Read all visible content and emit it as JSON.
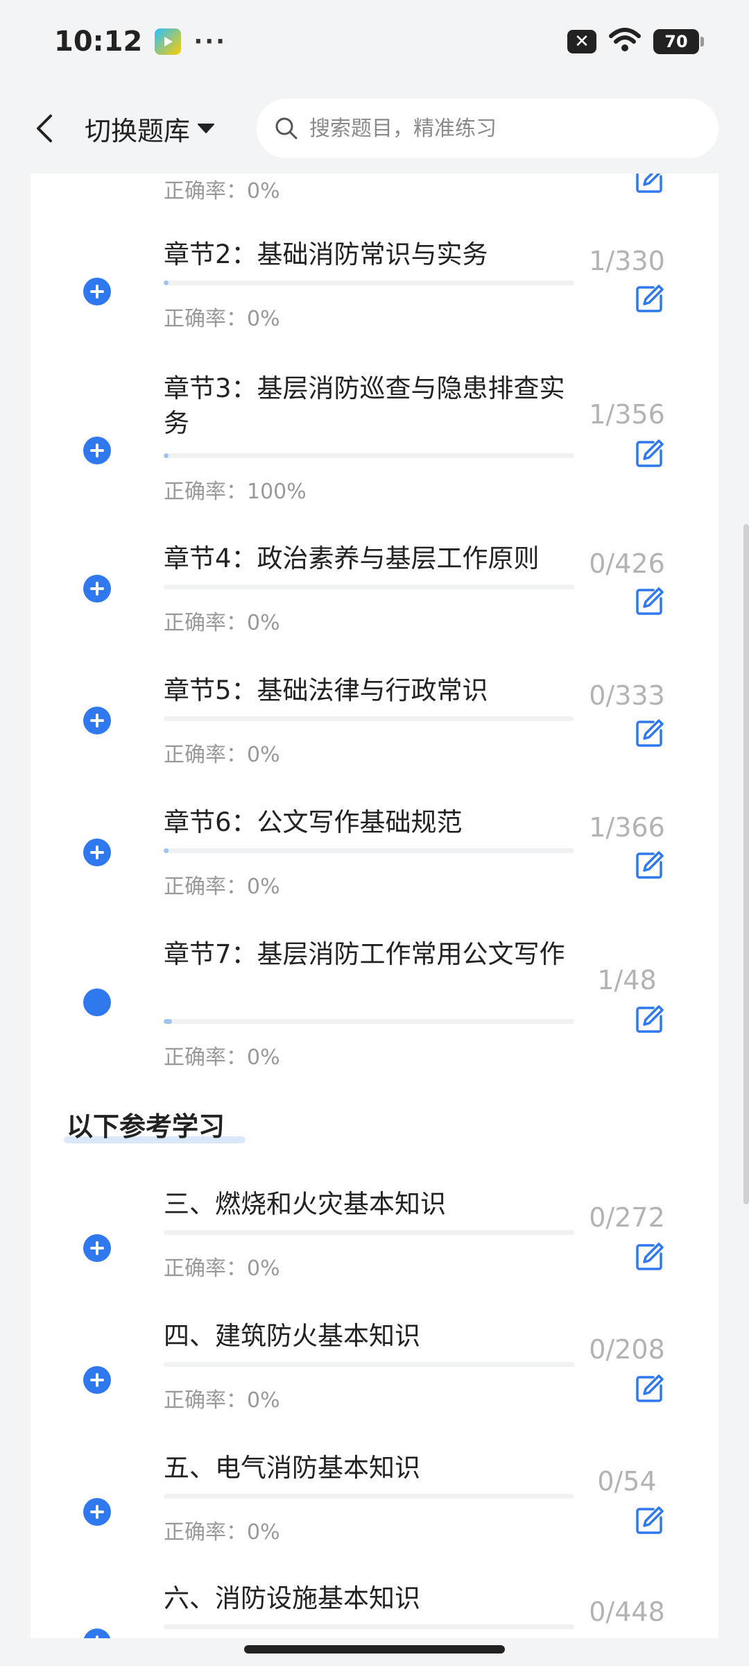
{
  "status": {
    "time": "10:12",
    "dots": "···",
    "battery": "70"
  },
  "header": {
    "switch_label": "切换题库",
    "search_placeholder": "搜索题目，精准练习"
  },
  "top_partial": {
    "accuracy": "正确率：0%"
  },
  "chapters": [
    {
      "title": "章节2：基础消防常识与实务",
      "accuracy": "正确率：0%",
      "count": "1/330",
      "progress": 0.003,
      "icon": "plus-circle-icon"
    },
    {
      "title": "章节3：基层消防巡查与隐患排查实务",
      "accuracy": "正确率：100%",
      "count": "1/356",
      "progress": 0.003,
      "icon": "plus-circle-icon"
    },
    {
      "title": "章节4：政治素养与基层工作原则",
      "accuracy": "正确率：0%",
      "count": "0/426",
      "progress": 0,
      "icon": "plus-circle-icon"
    },
    {
      "title": "章节5：基础法律与行政常识",
      "accuracy": "正确率：0%",
      "count": "0/333",
      "progress": 0,
      "icon": "plus-circle-icon"
    },
    {
      "title": "章节6：公文写作基础规范",
      "accuracy": "正确率：0%",
      "count": "1/366",
      "progress": 0.003,
      "icon": "plus-circle-icon"
    },
    {
      "title": "章节7：基层消防工作常用公文写作",
      "accuracy": "正确率：0%",
      "count": "1/48",
      "progress": 0.021,
      "icon": "dot-circle-icon"
    }
  ],
  "reference_section": {
    "title": "以下参考学习"
  },
  "reference_items": [
    {
      "title": "三、燃烧和火灾基本知识",
      "accuracy": "正确率：0%",
      "count": "0/272",
      "progress": 0
    },
    {
      "title": "四、建筑防火基本知识",
      "accuracy": "正确率：0%",
      "count": "0/208",
      "progress": 0
    },
    {
      "title": "五、电气消防基本知识",
      "accuracy": "正确率：0%",
      "count": "0/54",
      "progress": 0
    },
    {
      "title": "六、消防设施基本知识",
      "accuracy": "",
      "count": "0/448",
      "progress": 0
    }
  ],
  "colors": {
    "accent": "#2f78ee",
    "count_gray": "#b3b3b3",
    "accuracy_gray": "#999999"
  }
}
